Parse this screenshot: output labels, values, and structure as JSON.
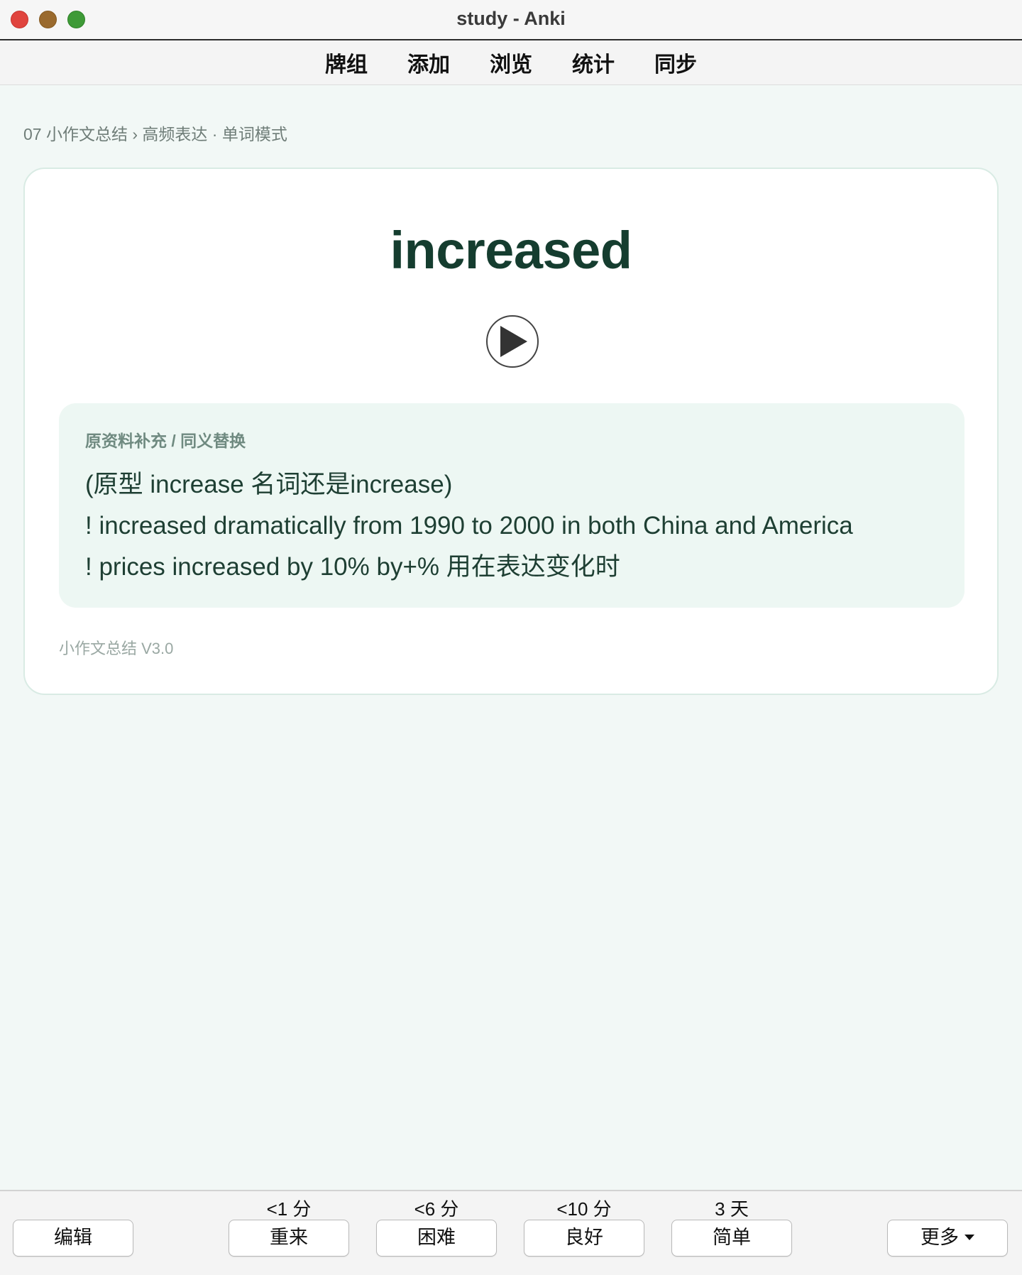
{
  "window": {
    "title": "study - Anki"
  },
  "toolbar": {
    "items": [
      "牌组",
      "添加",
      "浏览",
      "统计",
      "同步"
    ]
  },
  "breadcrumb": "07 小作文总结 › 高频表达 · 单词模式",
  "card": {
    "word": "increased",
    "note_label": "原资料补充 / 同义替换",
    "lines": [
      "(原型 increase 名词还是increase)",
      "! increased dramatically from 1990 to 2000 in both China and America",
      "! prices increased by 10% by+% 用在表达变化时"
    ],
    "footer": "小作文总结 V3.0"
  },
  "answer_bar": {
    "edit_label": "编辑",
    "more_label": "更多",
    "buttons": [
      {
        "timing": "<1 分",
        "label": "重来"
      },
      {
        "timing": "<6 分",
        "label": "困难"
      },
      {
        "timing": "<10 分",
        "label": "良好"
      },
      {
        "timing": "3 天",
        "label": "简单"
      }
    ]
  },
  "colors": {
    "accent": "#153d2f",
    "card_bg": "#ffffff",
    "note_bg": "#edf7f3",
    "page_bg": "#f2f8f6"
  },
  "icons": [
    "close-icon",
    "minimize-icon",
    "maximize-icon",
    "play-icon",
    "chevron-down-icon"
  ]
}
